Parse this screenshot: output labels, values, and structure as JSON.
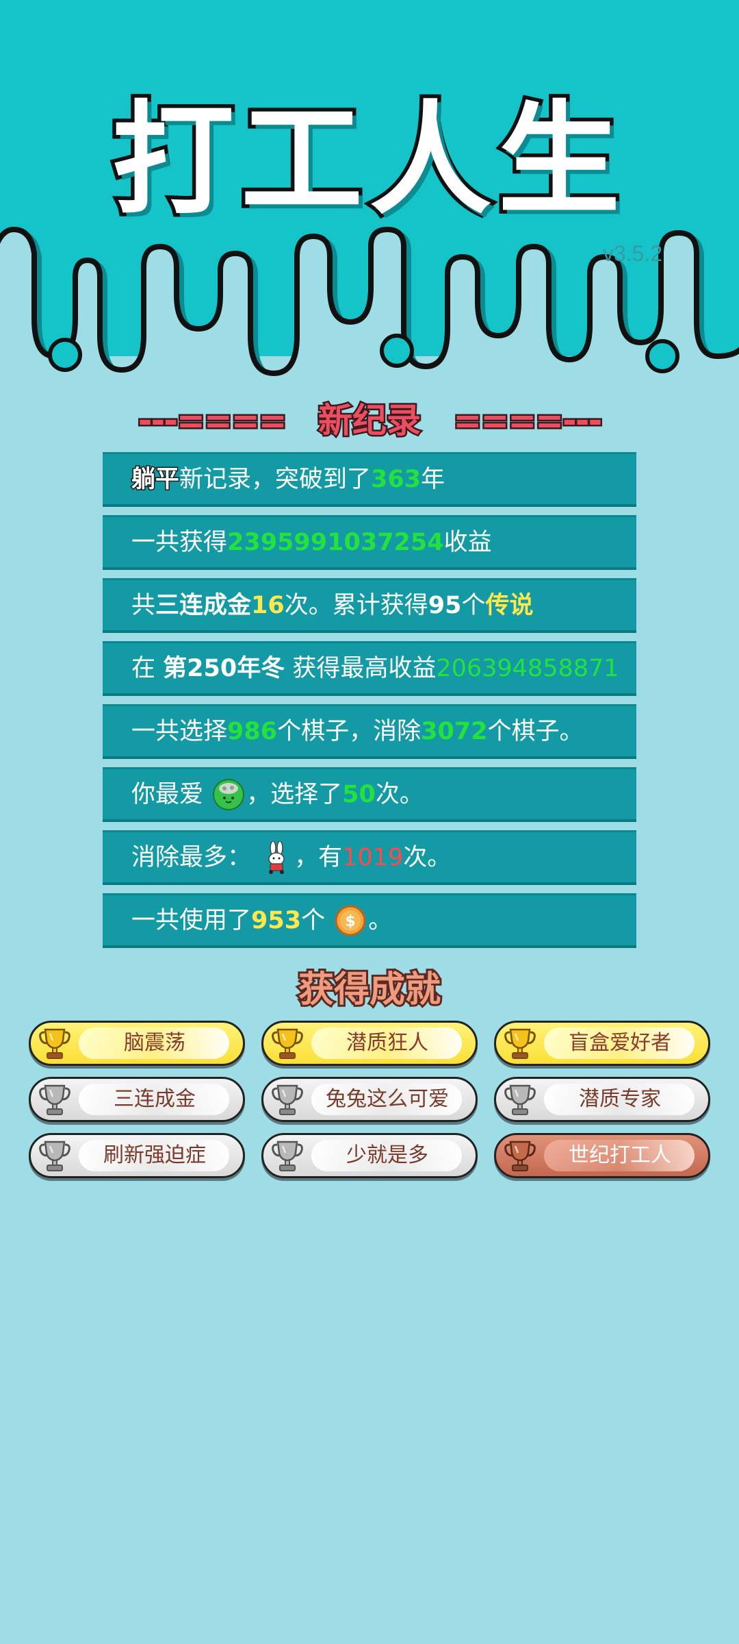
{
  "header": {
    "title": "打工人生",
    "version": "v3.5.2"
  },
  "record": {
    "heading": "新纪录",
    "dashes_left": "---====",
    "dashes_right": "====---",
    "rows": [
      {
        "parts": [
          "躺平",
          "新记录，突破到了",
          "363",
          "年"
        ]
      },
      {
        "parts": [
          "一共获得",
          "2395991037254",
          "收益"
        ]
      },
      {
        "parts": [
          "共",
          "三连成金",
          "16",
          "次。累计获得",
          "95",
          "个",
          "传说"
        ]
      },
      {
        "parts": [
          "在 ",
          "第250年冬",
          " 获得最高收益",
          "206394858871"
        ]
      },
      {
        "parts": [
          "一共选择",
          "986",
          "个棋子，消除",
          "3072",
          "个棋子。"
        ]
      },
      {
        "parts": [
          "你最爱",
          "，选择了",
          "50",
          "次。"
        ]
      },
      {
        "parts": [
          "消除最多：",
          "，有",
          "1019",
          "次。"
        ]
      },
      {
        "parts": [
          "一共使用了",
          "953",
          "个",
          "。"
        ]
      }
    ]
  },
  "achievements": {
    "heading": "获得成就",
    "items": [
      {
        "label": "脑震荡",
        "tier": "gold"
      },
      {
        "label": "潜质狂人",
        "tier": "gold"
      },
      {
        "label": "盲盒爱好者",
        "tier": "gold"
      },
      {
        "label": "三连成金",
        "tier": "silver"
      },
      {
        "label": "兔兔这么可爱",
        "tier": "silver"
      },
      {
        "label": "潜质专家",
        "tier": "silver"
      },
      {
        "label": "刷新强迫症",
        "tier": "silver"
      },
      {
        "label": "少就是多",
        "tier": "silver"
      },
      {
        "label": "世纪打工人",
        "tier": "bronze"
      }
    ]
  },
  "colors": {
    "background": "#9fdde6",
    "header": "#14c4c8",
    "row": "#139aa5",
    "green_value": "#23e23c",
    "yellow_value": "#ffe94a",
    "red_value": "#ff4a4a",
    "heading_red": "#ee4c5f"
  },
  "icons": [
    "trophy-icon",
    "cabbage-icon",
    "rabbit-icon",
    "coin-icon"
  ]
}
